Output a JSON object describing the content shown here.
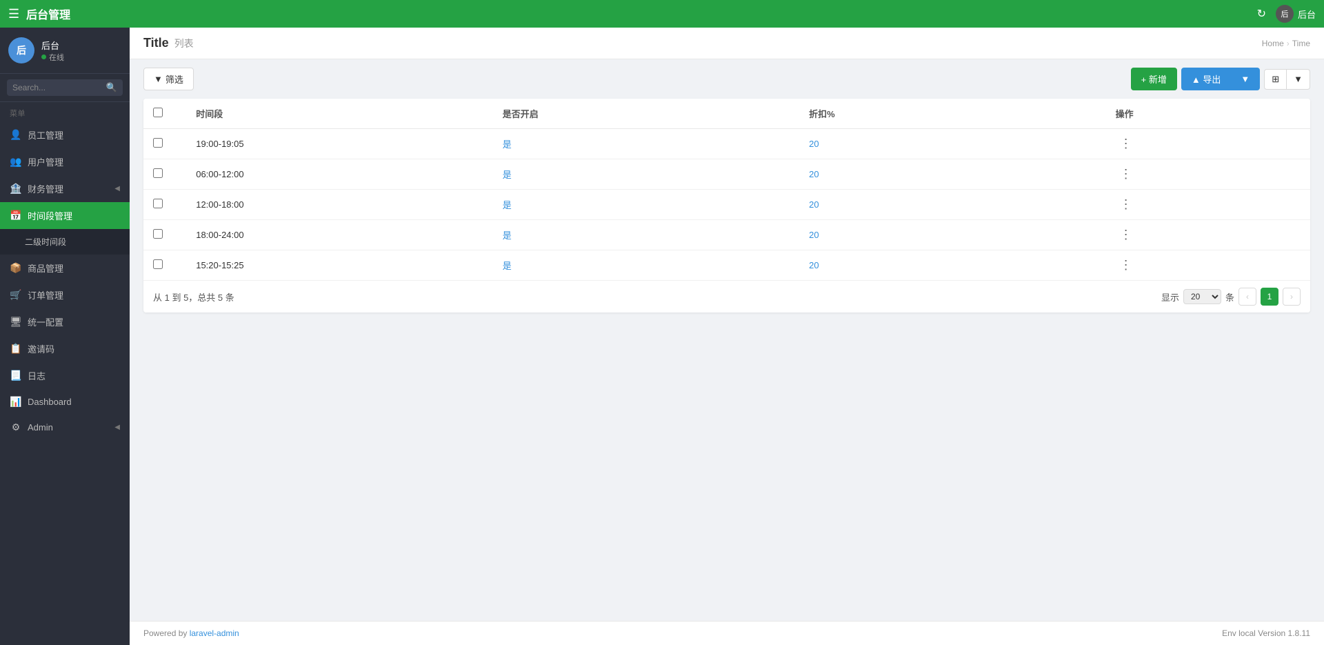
{
  "app": {
    "title": "后台管理"
  },
  "topnav": {
    "hamburger": "☰",
    "refresh_icon": "↻",
    "username": "后台",
    "avatar_text": "后"
  },
  "sidebar": {
    "avatar_text": "后",
    "username": "后台",
    "status": "在线",
    "search_placeholder": "Search...",
    "section_label": "菜单",
    "items": [
      {
        "id": "staff",
        "icon": "👤",
        "label": "员工管理",
        "active": false,
        "arrow": false
      },
      {
        "id": "user",
        "icon": "👥",
        "label": "用户管理",
        "active": false,
        "arrow": false
      },
      {
        "id": "finance",
        "icon": "🏦",
        "label": "财务管理",
        "active": false,
        "arrow": true
      },
      {
        "id": "time",
        "icon": "📅",
        "label": "时间段管理",
        "active": true,
        "arrow": false
      },
      {
        "id": "time2",
        "icon": "",
        "label": "二级时间段",
        "active": false,
        "arrow": false,
        "sub": true
      },
      {
        "id": "goods",
        "icon": "📦",
        "label": "商品管理",
        "active": false,
        "arrow": false
      },
      {
        "id": "order",
        "icon": "🛒",
        "label": "订单管理",
        "active": false,
        "arrow": false
      },
      {
        "id": "config",
        "icon": "🖥",
        "label": "统一配置",
        "active": false,
        "arrow": false
      },
      {
        "id": "invite",
        "icon": "📋",
        "label": "邀请码",
        "active": false,
        "arrow": false
      },
      {
        "id": "log",
        "icon": "📃",
        "label": "日志",
        "active": false,
        "arrow": false
      },
      {
        "id": "dashboard",
        "icon": "📊",
        "label": "Dashboard",
        "active": false,
        "arrow": false
      },
      {
        "id": "admin",
        "icon": "⚙",
        "label": "Admin",
        "active": false,
        "arrow": true
      }
    ]
  },
  "page": {
    "title": "Title",
    "subtitle": "列表",
    "breadcrumb": [
      {
        "label": "Home",
        "href": "#"
      },
      {
        "label": "Time"
      }
    ]
  },
  "toolbar": {
    "filter_label": "筛选",
    "new_label": "+ 新增",
    "export_label": "▲ 导出",
    "export_arrow": "▼",
    "columns_icon": "⊞"
  },
  "table": {
    "columns": [
      "",
      "时间段",
      "是否开启",
      "折扣%",
      "操作"
    ],
    "rows": [
      {
        "id": 1,
        "time_range": "19:00-19:05",
        "enabled": "是",
        "discount": "20"
      },
      {
        "id": 2,
        "time_range": "06:00-12:00",
        "enabled": "是",
        "discount": "20"
      },
      {
        "id": 3,
        "time_range": "12:00-18:00",
        "enabled": "是",
        "discount": "20"
      },
      {
        "id": 4,
        "time_range": "18:00-24:00",
        "enabled": "是",
        "discount": "20"
      },
      {
        "id": 5,
        "time_range": "15:20-15:25",
        "enabled": "是",
        "discount": "20"
      }
    ],
    "summary": "从 1 到 5，总共 5 条",
    "pagination": {
      "show_label": "显示",
      "per_page": "20",
      "per_page_unit": "条",
      "current_page": 1,
      "total_pages": 1
    }
  },
  "footer": {
    "powered_by": "Powered by ",
    "link_text": "laravel-admin",
    "env_label": "Env",
    "env_value": "local",
    "version_label": "Version",
    "version_value": "1.8.11"
  }
}
